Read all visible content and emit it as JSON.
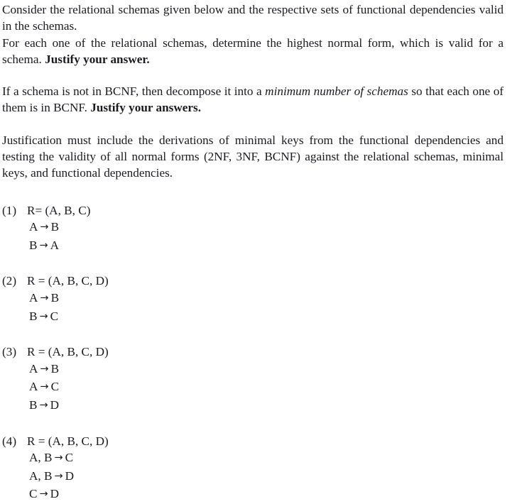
{
  "document": {
    "intro": {
      "paragraph_1_part_1": "Consider the relational schemas given below and the respective sets of functional dependencies valid in the schemas.",
      "paragraph_1_part_2": "For each one of the relational schemas, determine the highest normal form, which is valid for a schema. ",
      "paragraph_1_bold": "Justify your answer.",
      "paragraph_2_part_1": "If a schema is not in BCNF, then decompose it into a ",
      "paragraph_2_italic": "minimum number of schemas",
      "paragraph_2_part_2": " so that each one of them is in BCNF. ",
      "paragraph_2_bold": "Justify your answers.",
      "paragraph_3": "Justification must include the derivations of minimal keys from the functional dependencies and testing the validity of all normal forms (2NF, 3NF, BCNF) against the relational schemas, minimal keys, and functional dependencies."
    },
    "arrow_glyph": "→",
    "schemas": [
      {
        "number": "(1)",
        "relation": "R= (A, B, C)",
        "dependencies": [
          {
            "lhs": "A",
            "rhs": "B"
          },
          {
            "lhs": "B",
            "rhs": "A"
          }
        ]
      },
      {
        "number": "(2)",
        "relation": "R = (A, B, C, D)",
        "dependencies": [
          {
            "lhs": "A",
            "rhs": "B"
          },
          {
            "lhs": "B",
            "rhs": "C"
          }
        ]
      },
      {
        "number": "(3)",
        "relation": "R = (A, B, C, D)",
        "dependencies": [
          {
            "lhs": "A",
            "rhs": "B"
          },
          {
            "lhs": "A",
            "rhs": "C"
          },
          {
            "lhs": "B",
            "rhs": "D"
          }
        ]
      },
      {
        "number": "(4)",
        "relation": "R = (A, B, C, D)",
        "dependencies": [
          {
            "lhs": "A, B",
            "rhs": "C"
          },
          {
            "lhs": "A, B",
            "rhs": "D"
          },
          {
            "lhs": "C",
            "rhs": "D"
          }
        ]
      }
    ]
  }
}
